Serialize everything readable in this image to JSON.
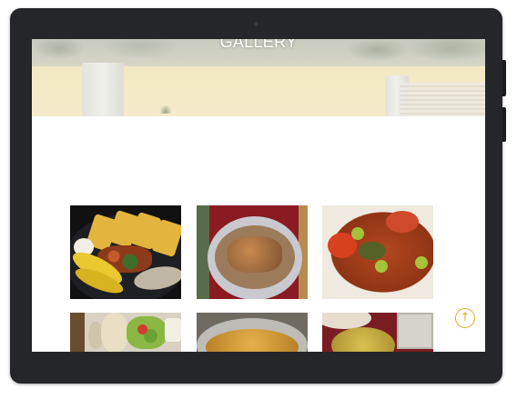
{
  "hero": {
    "title": "GALLERY"
  },
  "gallery": {
    "photos": [
      {
        "icon": "plantain-fish-platter-photo"
      },
      {
        "icon": "covered-platter-photo"
      },
      {
        "icon": "crab-stew-photo"
      },
      {
        "icon": "fufu-salad-photo"
      },
      {
        "icon": "soup-pot-photo"
      },
      {
        "icon": "stew-bowls-photo"
      }
    ]
  },
  "scroll_top": {
    "icon": "arrow-up-circle-icon",
    "glyph": "↑"
  },
  "colors": {
    "accent": "#e0ad2e",
    "device": "#25262a",
    "screen": "#ffffff"
  }
}
